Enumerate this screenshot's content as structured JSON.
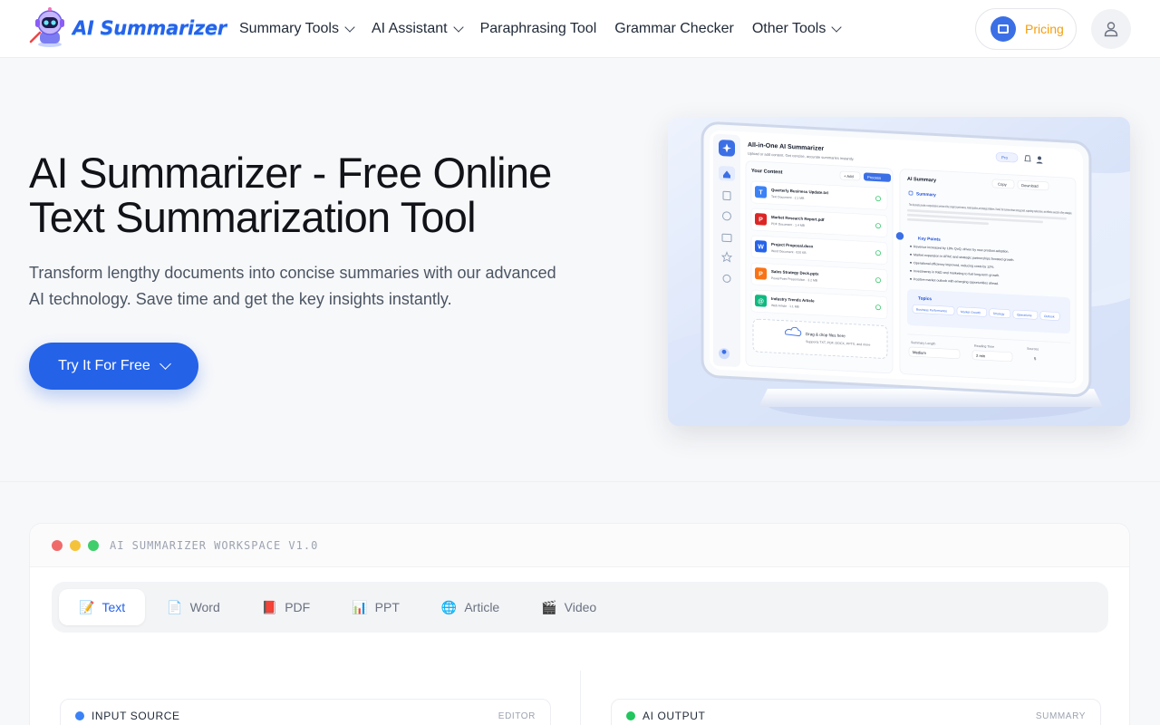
{
  "nav": {
    "logo_text": "AI Summarizer",
    "menu": [
      {
        "label": "Summary Tools",
        "dropdown": true
      },
      {
        "label": "AI Assistant",
        "dropdown": true
      },
      {
        "label": "Paraphrasing Tool",
        "dropdown": false
      },
      {
        "label": "Grammar Checker",
        "dropdown": false
      },
      {
        "label": "Other Tools",
        "dropdown": true
      }
    ],
    "pricing_label": "Pricing"
  },
  "hero": {
    "title": "AI Summarizer - Free Online Text Summarization Tool",
    "subtitle": "Transform lengthy documents into concise summaries with our advanced AI technology. Save time and get the key insights instantly.",
    "cta_label": "Try It For Free",
    "mockup": {
      "app_title": "All-in-One AI Summarizer",
      "app_subtitle": "Upload or add content. Get concise, accurate summaries instantly.",
      "pro_label": "Pro",
      "content_title": "Your Content",
      "add_label": "+ Add",
      "process_label": "Process",
      "files": [
        {
          "name": "Quarterly Business Update.txt",
          "meta": "Text Document · 2.1 MB",
          "type": "T",
          "color": "#3b82f6"
        },
        {
          "name": "Market Research Report.pdf",
          "meta": "PDF Document · 1.4 MB",
          "type": "P",
          "color": "#dc2626"
        },
        {
          "name": "Project Proposal.docx",
          "meta": "Word Document · 820 KB",
          "type": "W",
          "color": "#2563eb"
        },
        {
          "name": "Sales Strategy Deck.pptx",
          "meta": "PowerPoint Presentation · 3.2 MB",
          "type": "P",
          "color": "#f97316"
        },
        {
          "name": "Industry Trends Article",
          "meta": "Web Article · 1.1 MB",
          "type": "@",
          "color": "#10b981"
        }
      ],
      "drop_title": "Drag & drop files here",
      "drop_sub": "Supports TXT, PDF, DOCX, PPTX, and more",
      "summary_panel_title": "AI Summary",
      "copy_label": "Copy",
      "download_label": "Download",
      "summary_heading": "Summary",
      "summary_text": "The documents provide a comprehensive overview of the company's performance, market position, and strategic initiatives. Overall, the business shows strong growth, expanding market share, and effective execution of key strategies.",
      "key_points_heading": "Key Points",
      "key_points": [
        "Revenue increased by 18% QoQ, driven by new product adoption.",
        "Market expansion in APAC and strategic partnerships boosted growth.",
        "Operational efficiency improved, reducing costs by 12%.",
        "Investments in R&D and marketing to fuel long-term growth.",
        "Positive market outlook with emerging opportunities ahead."
      ],
      "topics_heading": "Topics",
      "topics": [
        "Business Performance",
        "Market Growth",
        "Strategy",
        "Operations",
        "Outlook"
      ],
      "summary_length_label": "Summary Length",
      "summary_length_value": "Medium",
      "reading_time_label": "Reading Time",
      "reading_time_value": "2 min",
      "sources_label": "Sources",
      "sources_value": "5"
    }
  },
  "workspace": {
    "title": "AI SUMMARIZER WORKSPACE V1.0",
    "window_dots": [
      "#ef6b6b",
      "#f5c33b",
      "#3fce6b"
    ],
    "tabs": [
      {
        "icon": "📝",
        "label": "Text",
        "active": true
      },
      {
        "icon": "📄",
        "label": "Word",
        "active": false
      },
      {
        "icon": "📕",
        "label": "PDF",
        "active": false
      },
      {
        "icon": "📊",
        "label": "PPT",
        "active": false
      },
      {
        "icon": "🌐",
        "label": "Article",
        "active": false
      },
      {
        "icon": "🎬",
        "label": "Video",
        "active": false
      }
    ],
    "input_panel": {
      "label": "INPUT SOURCE",
      "tag": "EDITOR",
      "dot_color": "#3b82f6"
    },
    "output_panel": {
      "label": "AI OUTPUT",
      "tag": "SUMMARY",
      "dot_color": "#22c55e"
    }
  }
}
